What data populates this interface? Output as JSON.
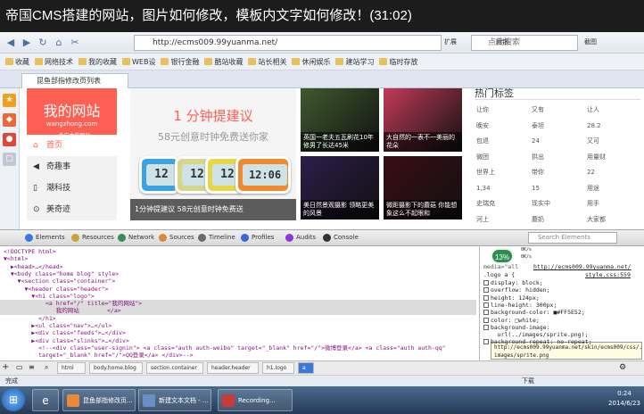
{
  "window": {
    "title": "帝国CMS搭建的网站，图片如何修改，模板内文字如何修改！(31:02)",
    "watermark": "优酷"
  },
  "browser": {
    "address": "http://ecms009.99yuanma.net/",
    "search_placeholder": "点此搜索",
    "toolbar": {
      "extensions": "扩展",
      "netbank": "网银",
      "translate": "翻译",
      "screenshot": "截图",
      "game": "游戏",
      "login": "登录"
    },
    "favorites": [
      "收藏",
      "网络技术",
      "我的收藏",
      "WEB设",
      "银行金融",
      "酷站收藏",
      "站长相关",
      "休闲娱乐",
      "建站学习",
      "临时存放"
    ],
    "tab": "昆鱼部指修改页列表"
  },
  "site": {
    "logo_title": "我的网站",
    "logo_domain": "wangzhong.com",
    "logo_slogan": "一个自由的网站",
    "nav": [
      {
        "icon": "home-icon",
        "label": "首页"
      },
      {
        "icon": "megaphone-icon",
        "label": "奇趣事"
      },
      {
        "icon": "phone-icon",
        "label": "潮科技"
      },
      {
        "icon": "pin-icon",
        "label": "美奇迹"
      }
    ],
    "banner": {
      "title": "1 分钟提建议",
      "subtitle": "58元创意时钟免费送你家",
      "caption": "1分钟提建议 58元创意时钟免费送",
      "clocks": [
        {
          "time": "12",
          "color": "#3aa3e0"
        },
        {
          "time": "12",
          "color": "#d6d68a"
        },
        {
          "time": "12",
          "color": "#e8d64a"
        },
        {
          "time": "12:06",
          "color": "#f08a2e"
        }
      ]
    },
    "thumbs": [
      {
        "caption": "英国一老夫五瓦刷花10年修男了长达45米",
        "color": "#3e5a2e"
      },
      {
        "caption": "大自然的一表不一美丽的花朵",
        "color": "#c23a58"
      },
      {
        "caption": "美日然景观摄影 领略更美的风景",
        "color": "#2d1d4a"
      },
      {
        "caption": "微距摄影下的蘑菇 你能想象这么不起眼和",
        "color": "#3a0d14"
      }
    ],
    "tags_title": "热门标签",
    "tags": [
      "让你",
      "又有",
      "让人",
      "晚安",
      "泰坦",
      "28.2",
      "包退",
      "24",
      "又可",
      "微团",
      "拱出",
      "用量财",
      "世界上",
      "带你",
      "22",
      "1,34",
      "15",
      "用途",
      "史瑞克",
      "现实中",
      "用手",
      "河上",
      "蘑奶",
      "大家都"
    ]
  },
  "devtools": {
    "tabs": [
      "Elements",
      "Resources",
      "Network",
      "Sources",
      "Timeline",
      "Profiles",
      "Audits",
      "Console"
    ],
    "search_placeholder": "Search Elements",
    "code_lines": [
      "<!DOCTYPE html>",
      "▼<html>",
      "  ▶<head>…</head>",
      "  ▼<body class=\"home blog\" style>",
      "    ▼<section class=\"container\">",
      "      ▼<header class=\"header\">",
      "        ▼<h1 class=\"logo\">",
      "            <a href=\"/\" title=\"我的网站\">",
      "               我的网站        </a>",
      "          </h1>",
      "        ▶<ul class=\"nav\">…</ul>",
      "        ▶<div class=\"feeds\">…</div>",
      "        ▶<div class=\"slinks\">…</div>",
      "          <!--<div class=\"user-signin\"> <a class=\"auth auth-weibo\" target=\"_blank\" href=\"/\">微博登录</a> <a class=\"auth auth-qq\"",
      "          target=\"_blank\" href=\"/\">QQ登录</a> </div>-->",
      "        </header>"
    ],
    "styles": {
      "badge": "13%",
      "net_up": "0K/s",
      "net_down": "0K/s",
      "rule_source": "http://ecms009.99yuanma.net/",
      "rule_file": "style.css:559",
      "media": "media=\"all\"",
      "selector": ".logo a {",
      "props": [
        "display: block;",
        "overflow: hidden;",
        "height: 124px;",
        "line-height: 300px;",
        "background-color: ■#FF5E52;",
        "color: □white;",
        "background-image:",
        "    url(../images/sprite.png);",
        "background-repeat: no-repeat;"
      ],
      "tooltip": "http://ecms009.99yuanma.net/skin/ecms009/css/../\nimages/sprite.png"
    },
    "breadcrumbs": [
      "html",
      "body.home.blog",
      "section.container",
      "header.header",
      "h1.logo",
      "a"
    ]
  },
  "statusbar": {
    "left": "完成",
    "download": "下载"
  },
  "taskbar": {
    "items": [
      {
        "label": "昆鱼部指修改页...",
        "color": "#e8883a"
      },
      {
        "label": "新建文本文档 - ...",
        "color": "#6a8fc7"
      },
      {
        "label": "Recording...",
        "color": "#c93a3a"
      }
    ],
    "time": "0:24",
    "date": "2014/6/23"
  }
}
